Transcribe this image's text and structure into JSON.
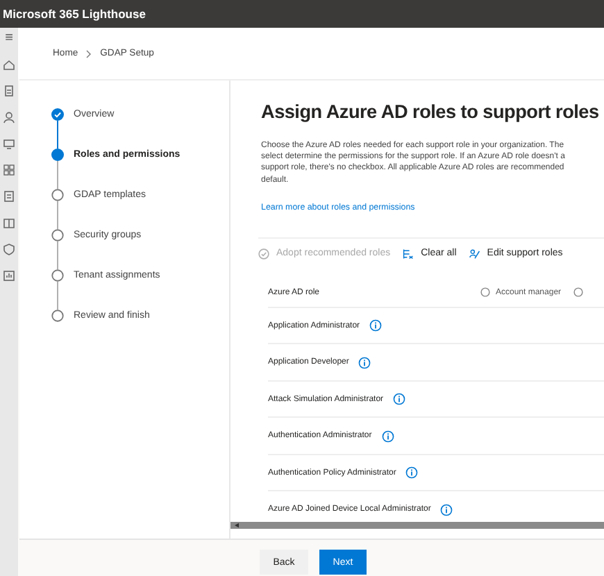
{
  "app": {
    "title": "Microsoft 365 Lighthouse"
  },
  "rail": {
    "menu": "≡"
  },
  "breadcrumb": [
    {
      "label": "Home"
    },
    {
      "label": "GDAP Setup"
    }
  ],
  "steps": [
    {
      "label": "Overview",
      "completed": true,
      "selected": false
    },
    {
      "label": "Roles and permissions",
      "completed": false,
      "selected": true
    },
    {
      "label": "GDAP templates",
      "completed": false,
      "selected": false
    },
    {
      "label": "Security groups",
      "completed": false,
      "selected": false
    },
    {
      "label": "Tenant assignments",
      "completed": false,
      "selected": false
    },
    {
      "label": "Review and finish",
      "completed": false,
      "selected": false
    }
  ],
  "heading": "Assign Azure AD roles to support roles",
  "description_lines": [
    "Choose the Azure AD roles needed for each support role in your organization. The",
    "select determine the permissions for the support role. If an Azure AD role doesn't a",
    "support role, there's no checkbox. All applicable Azure AD roles are recommended",
    "default."
  ],
  "link": "Learn more about roles and permissions",
  "toolbar": [
    {
      "label": "Adopt recommended roles",
      "kind": "adopt",
      "disabled": true
    },
    {
      "label": "Clear all",
      "kind": "clear",
      "disabled": false
    },
    {
      "label": "Edit support roles",
      "kind": "edit",
      "disabled": false
    }
  ],
  "table": {
    "columns": [
      "Azure AD role",
      "Account manager"
    ],
    "rows": [
      "Application Administrator",
      "Application Developer",
      "Attack Simulation Administrator",
      "Authentication Administrator",
      "Authentication Policy Administrator",
      "Azure AD Joined Device Local Administrator"
    ]
  },
  "buttons": [
    {
      "label": "Back",
      "kind": "secondary"
    },
    {
      "label": "Next",
      "kind": "primary"
    }
  ]
}
